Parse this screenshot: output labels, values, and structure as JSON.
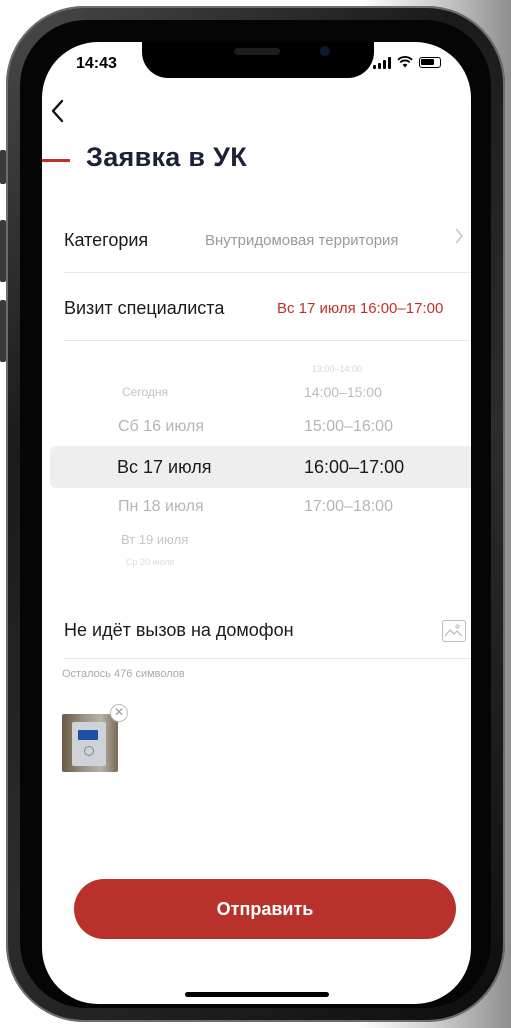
{
  "status_bar": {
    "time": "14:43"
  },
  "header": {
    "back_icon": "chevron-left-icon",
    "title": "Заявка в УК"
  },
  "form": {
    "category": {
      "label": "Категория",
      "value": "Внутридомовая территория"
    },
    "visit": {
      "label": "Визит специалиста",
      "value": "Вс 17 июля 16:00–17:00"
    }
  },
  "picker": {
    "dates": [
      "Сегодня",
      "Сб 16 июля",
      "Вс 17 июля",
      "Пн 18 июля",
      "Вт 19 июля",
      "Ср 20 июля"
    ],
    "times": [
      "13:00–14:00",
      "14:00–15:00",
      "15:00–16:00",
      "16:00–17:00",
      "17:00–18:00"
    ],
    "selected_date": "Вс 17 июля",
    "selected_time": "16:00–17:00"
  },
  "description": {
    "text": "Не идёт вызов на домофон",
    "counter": "Осталось 476 символов",
    "attach_icon": "image-icon"
  },
  "attachments": {
    "remove_icon": "close-icon"
  },
  "submit_label": "Отправить",
  "colors": {
    "accent": "#c0302a",
    "button": "#b8322b",
    "title": "#1b2235"
  }
}
